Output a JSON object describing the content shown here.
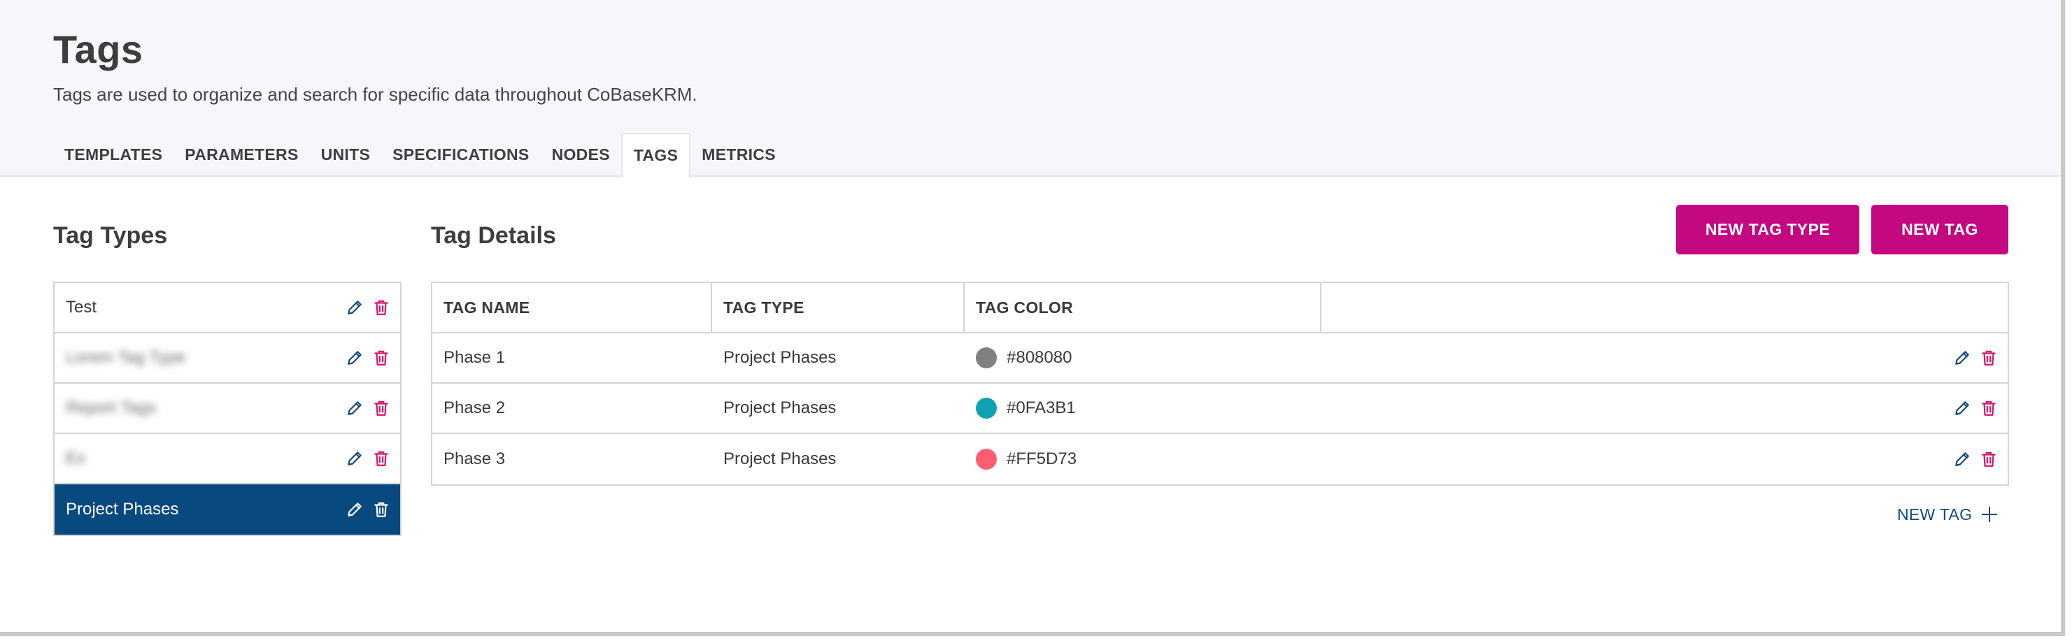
{
  "header": {
    "title": "Tags",
    "subtitle": "Tags are used to organize and search for specific data throughout CoBaseKRM."
  },
  "tabs": [
    {
      "label": "TEMPLATES",
      "active": false
    },
    {
      "label": "PARAMETERS",
      "active": false
    },
    {
      "label": "UNITS",
      "active": false
    },
    {
      "label": "SPECIFICATIONS",
      "active": false
    },
    {
      "label": "NODES",
      "active": false
    },
    {
      "label": "TAGS",
      "active": true
    },
    {
      "label": "METRICS",
      "active": false
    }
  ],
  "tag_types": {
    "title": "Tag Types",
    "items": [
      {
        "label": "Test",
        "blurred": false,
        "selected": false
      },
      {
        "label": "Lorem Tag Type",
        "blurred": true,
        "selected": false
      },
      {
        "label": "Report Tags",
        "blurred": true,
        "selected": false
      },
      {
        "label": "Ex",
        "blurred": true,
        "selected": false
      },
      {
        "label": "Project Phases",
        "blurred": false,
        "selected": true
      }
    ]
  },
  "tag_details": {
    "title": "Tag Details",
    "columns": [
      "TAG NAME",
      "TAG TYPE",
      "TAG COLOR",
      ""
    ],
    "rows": [
      {
        "name": "Phase 1",
        "type": "Project Phases",
        "color": "#808080"
      },
      {
        "name": "Phase 2",
        "type": "Project Phases",
        "color": "#0FA3B1"
      },
      {
        "name": "Phase 3",
        "type": "Project Phases",
        "color": "#FF5D73"
      }
    ],
    "new_tag_link": "NEW TAG"
  },
  "buttons": {
    "new_tag_type": "NEW TAG TYPE",
    "new_tag": "NEW TAG"
  },
  "colors": {
    "brand_magenta": "#c4087f",
    "selected_row": "#08497f",
    "edit_icon": "#15497c",
    "delete_icon": "#d4146a"
  },
  "icons": {
    "edit": "pencil-icon",
    "delete": "trash-icon",
    "add": "plus-icon"
  }
}
